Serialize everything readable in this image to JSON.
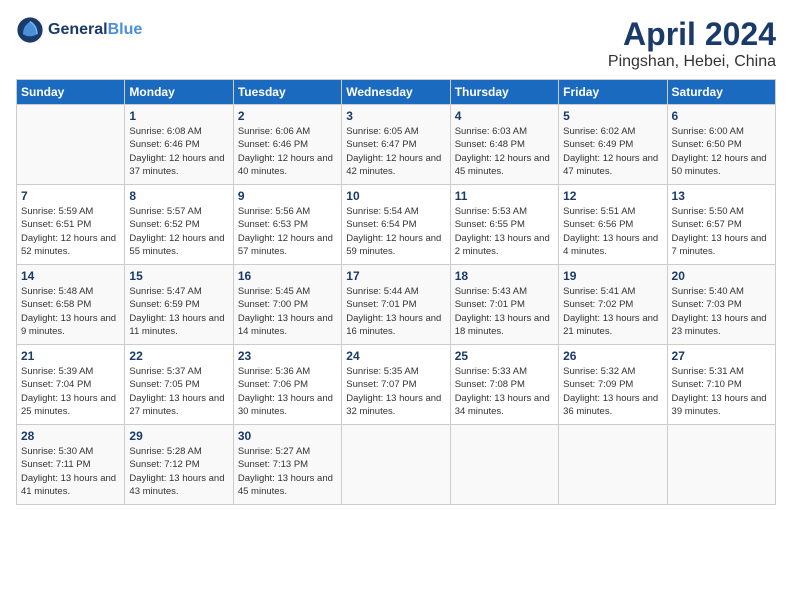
{
  "header": {
    "logo_line1": "General",
    "logo_line2": "Blue",
    "month": "April 2024",
    "location": "Pingshan, Hebei, China"
  },
  "weekdays": [
    "Sunday",
    "Monday",
    "Tuesday",
    "Wednesday",
    "Thursday",
    "Friday",
    "Saturday"
  ],
  "weeks": [
    [
      {
        "day": "",
        "sunrise": "",
        "sunset": "",
        "daylight": ""
      },
      {
        "day": "1",
        "sunrise": "6:08 AM",
        "sunset": "6:46 PM",
        "daylight": "12 hours and 37 minutes."
      },
      {
        "day": "2",
        "sunrise": "6:06 AM",
        "sunset": "6:46 PM",
        "daylight": "12 hours and 40 minutes."
      },
      {
        "day": "3",
        "sunrise": "6:05 AM",
        "sunset": "6:47 PM",
        "daylight": "12 hours and 42 minutes."
      },
      {
        "day": "4",
        "sunrise": "6:03 AM",
        "sunset": "6:48 PM",
        "daylight": "12 hours and 45 minutes."
      },
      {
        "day": "5",
        "sunrise": "6:02 AM",
        "sunset": "6:49 PM",
        "daylight": "12 hours and 47 minutes."
      },
      {
        "day": "6",
        "sunrise": "6:00 AM",
        "sunset": "6:50 PM",
        "daylight": "12 hours and 50 minutes."
      }
    ],
    [
      {
        "day": "7",
        "sunrise": "5:59 AM",
        "sunset": "6:51 PM",
        "daylight": "12 hours and 52 minutes."
      },
      {
        "day": "8",
        "sunrise": "5:57 AM",
        "sunset": "6:52 PM",
        "daylight": "12 hours and 55 minutes."
      },
      {
        "day": "9",
        "sunrise": "5:56 AM",
        "sunset": "6:53 PM",
        "daylight": "12 hours and 57 minutes."
      },
      {
        "day": "10",
        "sunrise": "5:54 AM",
        "sunset": "6:54 PM",
        "daylight": "12 hours and 59 minutes."
      },
      {
        "day": "11",
        "sunrise": "5:53 AM",
        "sunset": "6:55 PM",
        "daylight": "13 hours and 2 minutes."
      },
      {
        "day": "12",
        "sunrise": "5:51 AM",
        "sunset": "6:56 PM",
        "daylight": "13 hours and 4 minutes."
      },
      {
        "day": "13",
        "sunrise": "5:50 AM",
        "sunset": "6:57 PM",
        "daylight": "13 hours and 7 minutes."
      }
    ],
    [
      {
        "day": "14",
        "sunrise": "5:48 AM",
        "sunset": "6:58 PM",
        "daylight": "13 hours and 9 minutes."
      },
      {
        "day": "15",
        "sunrise": "5:47 AM",
        "sunset": "6:59 PM",
        "daylight": "13 hours and 11 minutes."
      },
      {
        "day": "16",
        "sunrise": "5:45 AM",
        "sunset": "7:00 PM",
        "daylight": "13 hours and 14 minutes."
      },
      {
        "day": "17",
        "sunrise": "5:44 AM",
        "sunset": "7:01 PM",
        "daylight": "13 hours and 16 minutes."
      },
      {
        "day": "18",
        "sunrise": "5:43 AM",
        "sunset": "7:01 PM",
        "daylight": "13 hours and 18 minutes."
      },
      {
        "day": "19",
        "sunrise": "5:41 AM",
        "sunset": "7:02 PM",
        "daylight": "13 hours and 21 minutes."
      },
      {
        "day": "20",
        "sunrise": "5:40 AM",
        "sunset": "7:03 PM",
        "daylight": "13 hours and 23 minutes."
      }
    ],
    [
      {
        "day": "21",
        "sunrise": "5:39 AM",
        "sunset": "7:04 PM",
        "daylight": "13 hours and 25 minutes."
      },
      {
        "day": "22",
        "sunrise": "5:37 AM",
        "sunset": "7:05 PM",
        "daylight": "13 hours and 27 minutes."
      },
      {
        "day": "23",
        "sunrise": "5:36 AM",
        "sunset": "7:06 PM",
        "daylight": "13 hours and 30 minutes."
      },
      {
        "day": "24",
        "sunrise": "5:35 AM",
        "sunset": "7:07 PM",
        "daylight": "13 hours and 32 minutes."
      },
      {
        "day": "25",
        "sunrise": "5:33 AM",
        "sunset": "7:08 PM",
        "daylight": "13 hours and 34 minutes."
      },
      {
        "day": "26",
        "sunrise": "5:32 AM",
        "sunset": "7:09 PM",
        "daylight": "13 hours and 36 minutes."
      },
      {
        "day": "27",
        "sunrise": "5:31 AM",
        "sunset": "7:10 PM",
        "daylight": "13 hours and 39 minutes."
      }
    ],
    [
      {
        "day": "28",
        "sunrise": "5:30 AM",
        "sunset": "7:11 PM",
        "daylight": "13 hours and 41 minutes."
      },
      {
        "day": "29",
        "sunrise": "5:28 AM",
        "sunset": "7:12 PM",
        "daylight": "13 hours and 43 minutes."
      },
      {
        "day": "30",
        "sunrise": "5:27 AM",
        "sunset": "7:13 PM",
        "daylight": "13 hours and 45 minutes."
      },
      {
        "day": "",
        "sunrise": "",
        "sunset": "",
        "daylight": ""
      },
      {
        "day": "",
        "sunrise": "",
        "sunset": "",
        "daylight": ""
      },
      {
        "day": "",
        "sunrise": "",
        "sunset": "",
        "daylight": ""
      },
      {
        "day": "",
        "sunrise": "",
        "sunset": "",
        "daylight": ""
      }
    ]
  ]
}
